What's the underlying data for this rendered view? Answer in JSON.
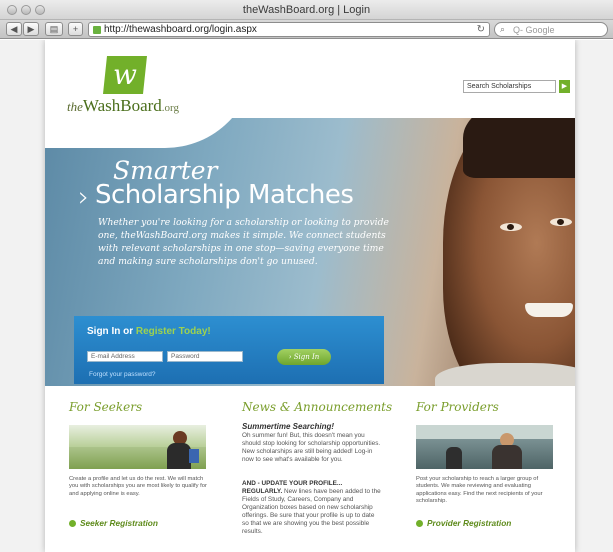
{
  "browser": {
    "window_title": "theWashBoard.org | Login",
    "url": "http://thewashboard.org/login.aspx",
    "search_placeholder": "Q- Google"
  },
  "header": {
    "logo_letter": "w",
    "logo_prefix": "the",
    "logo_name": "WashBoard",
    "logo_suffix": ".org",
    "search_placeholder": "Search Scholarships"
  },
  "hero": {
    "title_line1": "Smarter",
    "title_line2": "Scholarship Matches",
    "description": "Whether you're looking for a scholarship or looking to provide one, theWashBoard.org makes it simple. We connect students with relevant scholarships in one stop—saving everyone time and making sure scholarships don't go unused."
  },
  "signin": {
    "title_prefix": "Sign In or ",
    "title_link": "Register Today!",
    "email_placeholder": "E-mail Address",
    "password_placeholder": "Password",
    "button": "Sign In",
    "forgot": "Forgot your password?"
  },
  "seekers": {
    "title": "For Seekers",
    "text": "Create a profile and let us do the rest. We will match you with scholarships you are most likely to qualify for and applying online is easy.",
    "link": "Seeker Registration"
  },
  "news": {
    "title": "News & Announcements",
    "item1_heading": "Summertime Searching!",
    "item1_body": "Oh summer fun! But, this doesn't mean you should stop looking for scholarship opportunities. New scholarships are still being added! Log-in now to see what's available for you.",
    "item2_heading": "AND - UPDATE YOUR PROFILE... REGULARLY.",
    "item2_body": "New lines have been added to the Fields of Study, Careers, Company and Organization boxes based on new scholarship offerings. Be sure that your profile is up to date so that we are showing you the best possible results."
  },
  "providers": {
    "title": "For Providers",
    "text": "Post your scholarship to reach a larger group of students. We make reviewing and evaluating applications easy. Find the next recipients of your scholarship.",
    "link": "Provider Registration"
  }
}
